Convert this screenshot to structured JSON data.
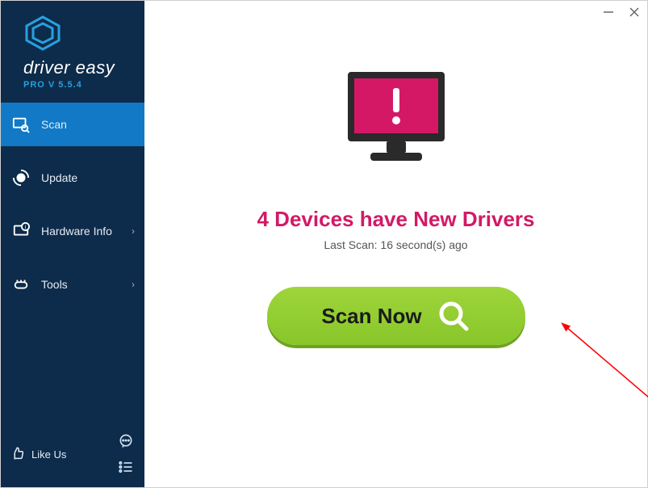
{
  "brand": {
    "name": "driver easy",
    "version_line": "PRO V 5.5.4"
  },
  "sidebar": {
    "items": [
      {
        "label": "Scan",
        "has_chevron": false,
        "active": true
      },
      {
        "label": "Update",
        "has_chevron": false,
        "active": false
      },
      {
        "label": "Hardware Info",
        "has_chevron": true,
        "active": false
      },
      {
        "label": "Tools",
        "has_chevron": true,
        "active": false
      }
    ],
    "like_us_label": "Like Us"
  },
  "main": {
    "headline": "4 Devices have New Drivers",
    "last_scan_text": "Last Scan: 16 second(s) ago",
    "scan_button_label": "Scan Now"
  },
  "colors": {
    "accent_pink": "#d41866",
    "sidebar_bg": "#0d2b4a",
    "active_blue": "#1179c6",
    "scan_green": "#92cf31"
  }
}
